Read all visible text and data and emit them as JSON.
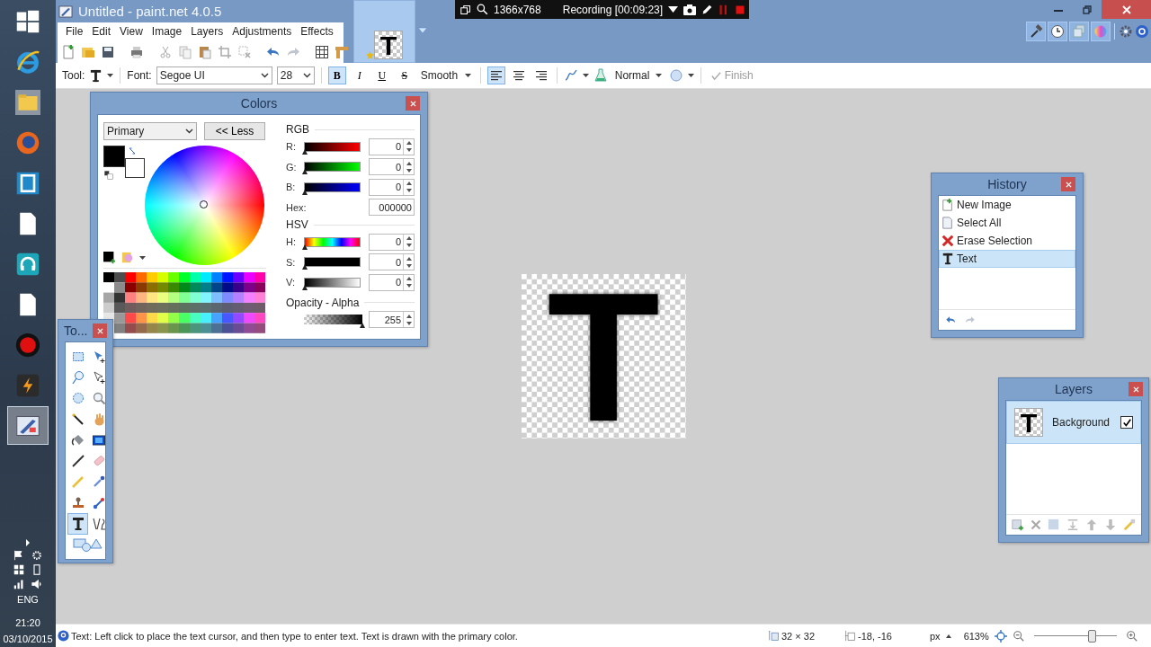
{
  "taskbar": {
    "apps": [
      {
        "kind": "start",
        "selected": false
      },
      {
        "kind": "browser",
        "selected": false
      },
      {
        "kind": "folder",
        "selected": false
      },
      {
        "kind": "firefox",
        "selected": false
      },
      {
        "kind": "app",
        "selected": false
      },
      {
        "kind": "document",
        "selected": false
      },
      {
        "kind": "headphones",
        "selected": false
      },
      {
        "kind": "document",
        "selected": false
      },
      {
        "kind": "record",
        "selected": false
      },
      {
        "kind": "editor",
        "selected": false
      },
      {
        "kind": "paint",
        "selected": true
      }
    ],
    "language": "ENG",
    "time": "21:20",
    "date": "03/10/2015"
  },
  "window": {
    "title": "Untitled - paint.net 4.0.5"
  },
  "menu": [
    "File",
    "Edit",
    "View",
    "Image",
    "Layers",
    "Adjustments",
    "Effects"
  ],
  "image_tab": {
    "thumbnail_text": "T"
  },
  "recorder": {
    "resolution": "1366x768",
    "status": "Recording [00:09:23]"
  },
  "panel_toggles": [
    {
      "kind": "tools",
      "on": true
    },
    {
      "kind": "history",
      "on": true
    },
    {
      "kind": "layers",
      "on": true
    },
    {
      "kind": "colors",
      "on": true
    }
  ],
  "toolbar": {
    "tool_label": "Tool:",
    "font_label": "Font:",
    "font": "Segoe UI",
    "size": "28",
    "styles": [
      {
        "kind": "bold",
        "label": "B",
        "selected": true
      },
      {
        "kind": "italic",
        "label": "I",
        "selected": false
      },
      {
        "kind": "underline",
        "label": "U",
        "selected": false
      },
      {
        "kind": "strike",
        "label": "S",
        "selected": false
      }
    ],
    "antialiasing": "Smooth",
    "alignments": [
      {
        "kind": "left",
        "selected": true
      },
      {
        "kind": "center",
        "selected": false
      },
      {
        "kind": "right",
        "selected": false
      }
    ],
    "blend_mode": "Normal",
    "finish": {
      "label": "Finish",
      "disabled": true
    }
  },
  "colors_window": {
    "title": "Colors",
    "target": "Primary",
    "less_button": "<< Less",
    "primary_swatch": {
      "color": "#000000"
    },
    "secondary_swatch": {
      "color": "#ffffff"
    },
    "rgb_label": "RGB",
    "rgb": [
      {
        "kind": "red",
        "label": "R:",
        "value": "0",
        "level": 0
      },
      {
        "kind": "green",
        "label": "G:",
        "value": "0",
        "level": 0
      },
      {
        "kind": "blue",
        "label": "B:",
        "value": "0",
        "level": 0
      }
    ],
    "hex_label": "Hex:",
    "hex": "000000",
    "hsv_label": "HSV",
    "hsv": [
      {
        "kind": "hue",
        "label": "H:",
        "value": "0",
        "level": 0
      },
      {
        "kind": "saturation",
        "label": "S:",
        "value": "0",
        "level": 0
      },
      {
        "kind": "value",
        "label": "V:",
        "value": "0",
        "level": 0
      }
    ],
    "alpha_label": "Opacity - Alpha",
    "alpha": {
      "value": "255",
      "level": 1
    }
  },
  "tools_window": {
    "title": "To...",
    "tools": [
      {
        "kind": "rectselect",
        "selected": false
      },
      {
        "kind": "move",
        "selected": false
      },
      {
        "kind": "lasso",
        "selected": false
      },
      {
        "kind": "movesel",
        "selected": false
      },
      {
        "kind": "ellipse",
        "selected": false
      },
      {
        "kind": "zoom",
        "selected": false
      },
      {
        "kind": "wand",
        "selected": false
      },
      {
        "kind": "pan",
        "selected": false
      },
      {
        "kind": "bucket",
        "selected": false
      },
      {
        "kind": "gradient",
        "selected": false
      },
      {
        "kind": "brush",
        "selected": false
      },
      {
        "kind": "eraser",
        "selected": false
      },
      {
        "kind": "pencil",
        "selected": false
      },
      {
        "kind": "picker",
        "selected": false
      },
      {
        "kind": "stamp",
        "selected": false
      },
      {
        "kind": "recolor",
        "selected": false
      },
      {
        "kind": "text",
        "selected": true
      },
      {
        "kind": "line",
        "selected": false
      },
      {
        "kind": "shapes",
        "selected": false
      }
    ]
  },
  "history_window": {
    "title": "History",
    "items": [
      {
        "kind": "new",
        "label": "New Image",
        "selected": false
      },
      {
        "kind": "page",
        "label": "Select All",
        "selected": false
      },
      {
        "kind": "erase",
        "label": "Erase Selection",
        "selected": false
      },
      {
        "kind": "text",
        "label": "Text",
        "selected": true
      }
    ],
    "undo_disabled": false,
    "redo_disabled": true
  },
  "layers_window": {
    "title": "Layers",
    "layers": [
      {
        "name": "Background",
        "thumbnail_text": "T",
        "visible": true,
        "selected": true
      }
    ]
  },
  "canvas": {
    "text": "T"
  },
  "status_bar": {
    "hint": "Text: Left click to place the text cursor, and then type to enter text. Text is drawn with the primary color.",
    "image_size": "32 × 32",
    "cursor": "-18, -16",
    "unit": "px",
    "zoom": "613%",
    "zoom_slider": {
      "level": 0.7
    }
  }
}
